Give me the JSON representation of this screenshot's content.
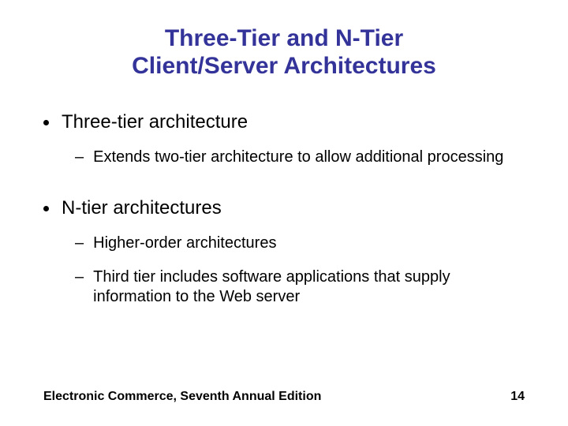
{
  "title_line1": "Three-Tier and N-Tier",
  "title_line2": "Client/Server Architectures",
  "bullets": {
    "b1": "Three-tier architecture",
    "b1_1": "Extends two-tier architecture to allow additional processing",
    "b2": "N-tier architectures",
    "b2_1": "Higher-order architectures",
    "b2_2": "Third tier includes software applications that supply information to the Web server"
  },
  "footer_left": "Electronic Commerce, Seventh Annual Edition",
  "footer_right": "14"
}
